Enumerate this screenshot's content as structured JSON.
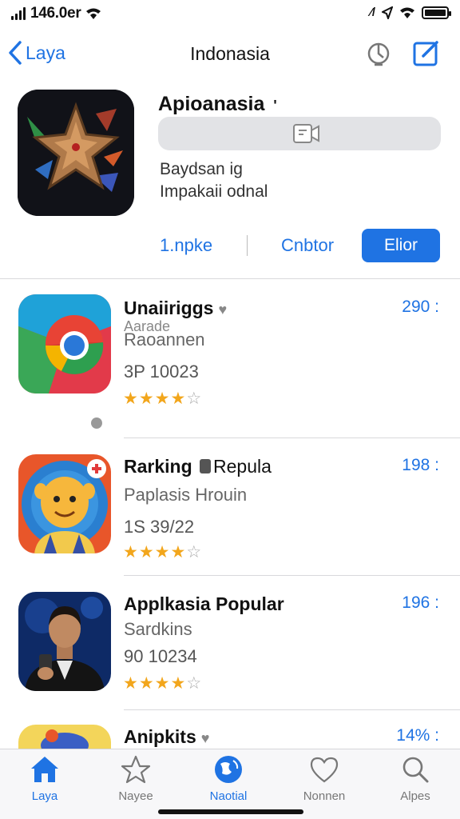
{
  "status_bar": {
    "time": "146.0er",
    "right_text": "⁄/"
  },
  "nav": {
    "back_label": "Laya",
    "title": "Indonasia"
  },
  "featured": {
    "name": "Apioanasia",
    "name_mark": "'",
    "line1": "Baydsan ig",
    "line2": "Impakaii odnal",
    "actions": {
      "link1": "1.npke",
      "link2": "Cnbtor",
      "primary": "Elior"
    }
  },
  "apps": [
    {
      "name": "Unaiiriggs",
      "tag": "♥",
      "subtitle_overlay": "Aarade",
      "subtitle": "Raoannen",
      "meta": "3P 10023",
      "rating": 4,
      "max_rating": 5,
      "price": "290 :"
    },
    {
      "name": "Rarking",
      "tag_text": "Repula",
      "subtitle": "Paplasis Hrouin",
      "meta": "1S 39/22",
      "rating": 4,
      "max_rating": 5,
      "price": "198 :"
    },
    {
      "name": "Applkasia Popular",
      "subtitle": "Sardkins",
      "meta": "90 10234",
      "rating": 4,
      "max_rating": 5,
      "price": "196 :"
    },
    {
      "name": "Anipkits",
      "tag": "♥",
      "price": "14% :"
    }
  ],
  "tabs": [
    {
      "label": "Laya",
      "icon": "home-icon",
      "active": true
    },
    {
      "label": "Nayee",
      "icon": "star-icon",
      "active": false
    },
    {
      "label": "Naotial",
      "icon": "globe-icon",
      "active": true
    },
    {
      "label": "Nonnen",
      "icon": "heart-icon",
      "active": false
    },
    {
      "label": "Alpes",
      "icon": "search-icon",
      "active": false
    }
  ],
  "colors": {
    "accent": "#1f73e3",
    "star": "#f2a61c",
    "divider": "#d9d9dc"
  }
}
